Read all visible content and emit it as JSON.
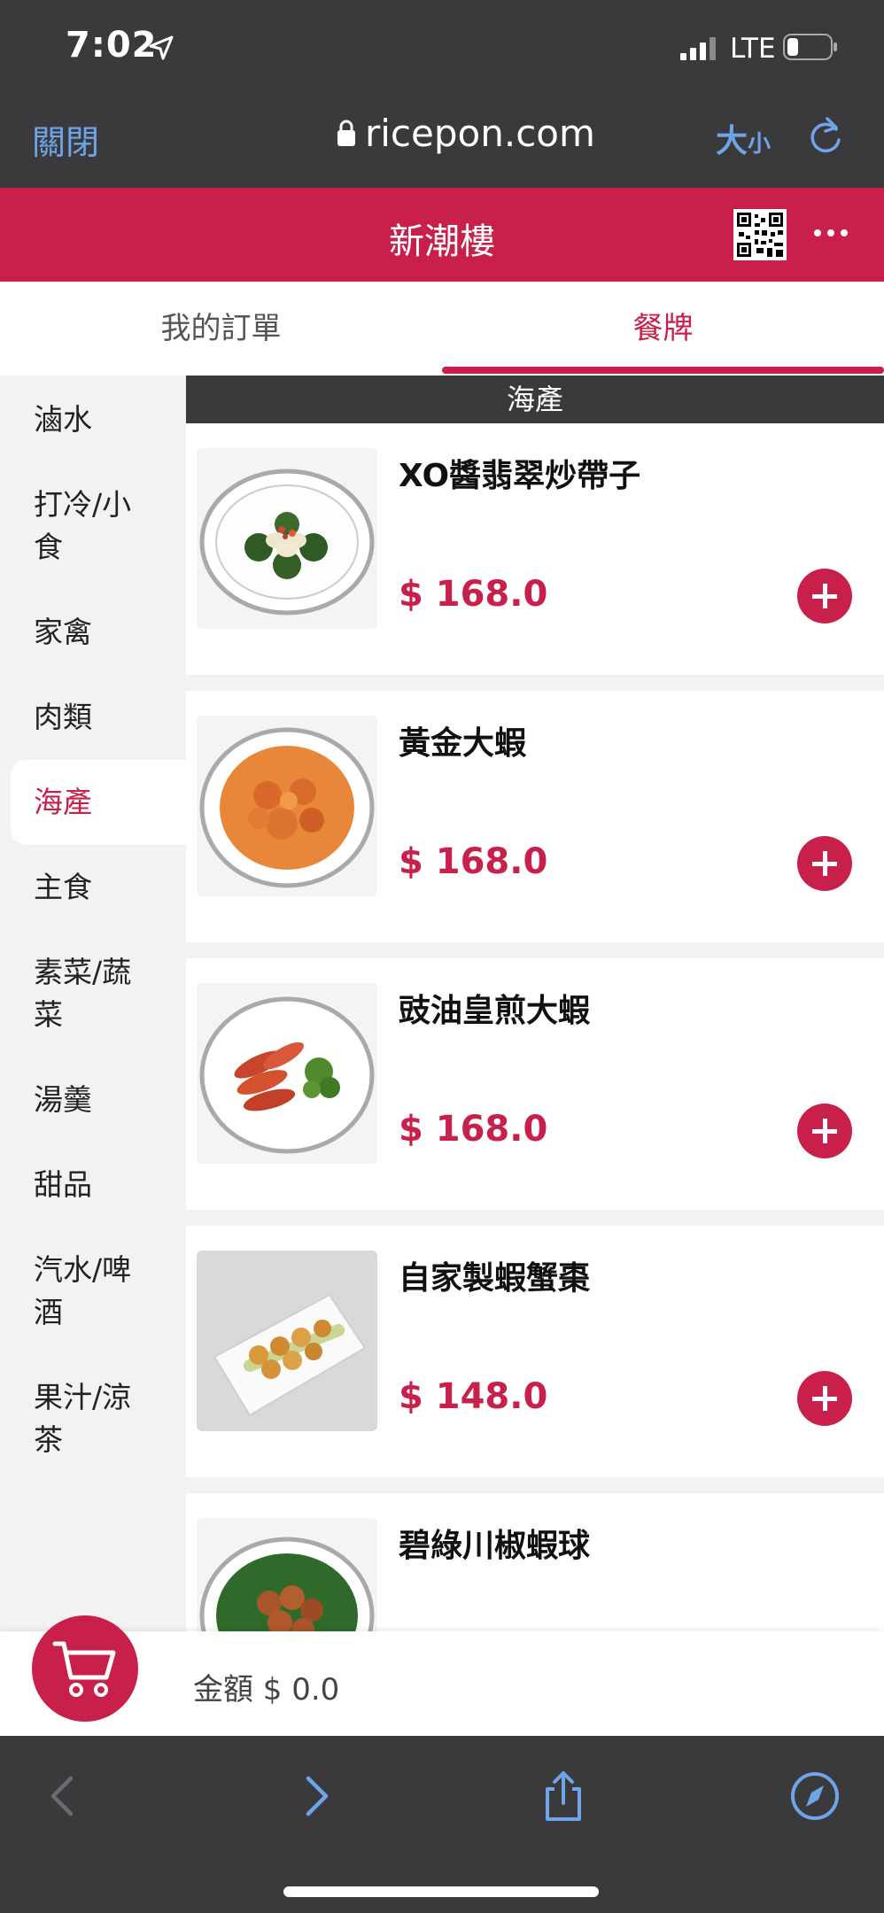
{
  "status_bar": {
    "time": "7:02",
    "network": "LTE"
  },
  "browser": {
    "close_label": "關閉",
    "url": "ricepon.com",
    "text_size_big": "大",
    "text_size_small": "小"
  },
  "header": {
    "title": "新潮樓"
  },
  "tabs": [
    {
      "label": "我的訂單"
    },
    {
      "label": "餐牌"
    }
  ],
  "categories": [
    {
      "label": "滷水"
    },
    {
      "label": "打冷/小食"
    },
    {
      "label": "家禽"
    },
    {
      "label": "肉類"
    },
    {
      "label": "海產"
    },
    {
      "label": "主食"
    },
    {
      "label": "素菜/蔬菜"
    },
    {
      "label": "湯羹"
    },
    {
      "label": "甜品"
    },
    {
      "label": "汽水/啤酒"
    },
    {
      "label": "果汁/涼茶"
    }
  ],
  "section": {
    "title": "海產"
  },
  "items": [
    {
      "name": "XO醬翡翠炒帶子",
      "price": "$ 168.0"
    },
    {
      "name": "黃金大蝦",
      "price": "$ 168.0"
    },
    {
      "name": "豉油皇煎大蝦",
      "price": "$ 168.0"
    },
    {
      "name": "自家製蝦蟹棗",
      "price": "$ 148.0"
    },
    {
      "name": "碧綠川椒蝦球",
      "price": ""
    }
  ],
  "cart": {
    "amount_label": "金額 $ 0.0"
  },
  "colors": {
    "accent": "#c8204a",
    "link": "#6fa5e8",
    "chrome": "#3a3a3c"
  }
}
